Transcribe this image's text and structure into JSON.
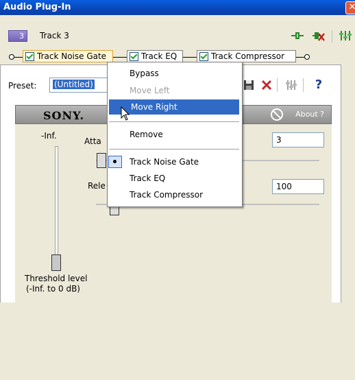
{
  "window": {
    "title": "Audio Plug-In",
    "close_glyph": "✕"
  },
  "track": {
    "number": "3",
    "name": "Track 3"
  },
  "chain": [
    {
      "label": "Track Noise Gate",
      "checked": true,
      "active": true
    },
    {
      "label": "Track EQ",
      "checked": true,
      "active": false
    },
    {
      "label": "Track Compressor",
      "checked": true,
      "active": false
    }
  ],
  "preset": {
    "label": "Preset:",
    "value": "(Untitled)"
  },
  "header": {
    "brand": "SONY.",
    "about_label": "About",
    "help_glyph": "?"
  },
  "plugin": {
    "level_value": "-Inf.",
    "attack_label": "Atta",
    "release_label": "Rele",
    "attack_value": "3",
    "release_value": "100",
    "threshold_label_1": "Threshold level",
    "threshold_label_2": "(-Inf. to 0 dB)"
  },
  "toolbar": {
    "help_glyph": "?"
  },
  "context_menu": {
    "items": [
      {
        "label": "Bypass",
        "state": "enabled"
      },
      {
        "label": "Move Left",
        "state": "disabled"
      },
      {
        "label": "Move Right",
        "state": "highlighted"
      },
      {
        "label": "Remove",
        "state": "enabled"
      },
      {
        "label": "Track Noise Gate",
        "state": "selected"
      },
      {
        "label": "Track EQ",
        "state": "enabled"
      },
      {
        "label": "Track Compressor",
        "state": "enabled"
      }
    ]
  }
}
